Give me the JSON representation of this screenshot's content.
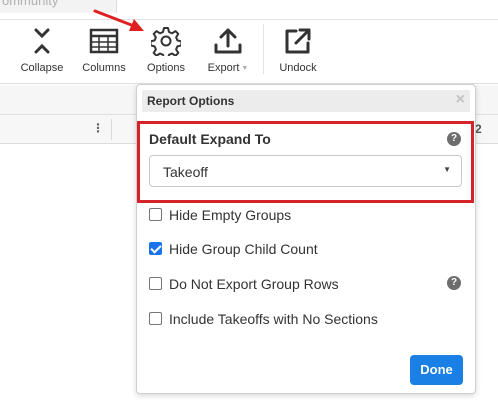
{
  "tabs": {
    "community": "ommunity"
  },
  "toolbar": {
    "collapse": {
      "label": "Collapse",
      "icon": "collapse-icon"
    },
    "columns": {
      "label": "Columns",
      "icon": "table-icon"
    },
    "options": {
      "label": "Options",
      "icon": "gear-icon"
    },
    "export": {
      "label": "Export",
      "icon": "upload-icon"
    },
    "undock": {
      "label": "Undock",
      "icon": "external-link-icon"
    }
  },
  "grid": {
    "column_menu": "⋮",
    "column_number": "2"
  },
  "popup": {
    "title": "Report Options",
    "close": "×",
    "default_expand": {
      "label": "Default Expand To",
      "value": "Takeoff",
      "help": "?"
    },
    "options": [
      {
        "label": "Hide Empty Groups",
        "checked": false
      },
      {
        "label": "Hide Group Child Count",
        "checked": true
      },
      {
        "label": "Do Not Export Group Rows",
        "checked": false,
        "help": "?"
      },
      {
        "label": "Include Takeoffs with No Sections",
        "checked": false
      }
    ],
    "done": "Done"
  },
  "colors": {
    "accent": "#1a80e6",
    "highlight": "#d5222b",
    "annotation_arrow": "#e02020"
  }
}
